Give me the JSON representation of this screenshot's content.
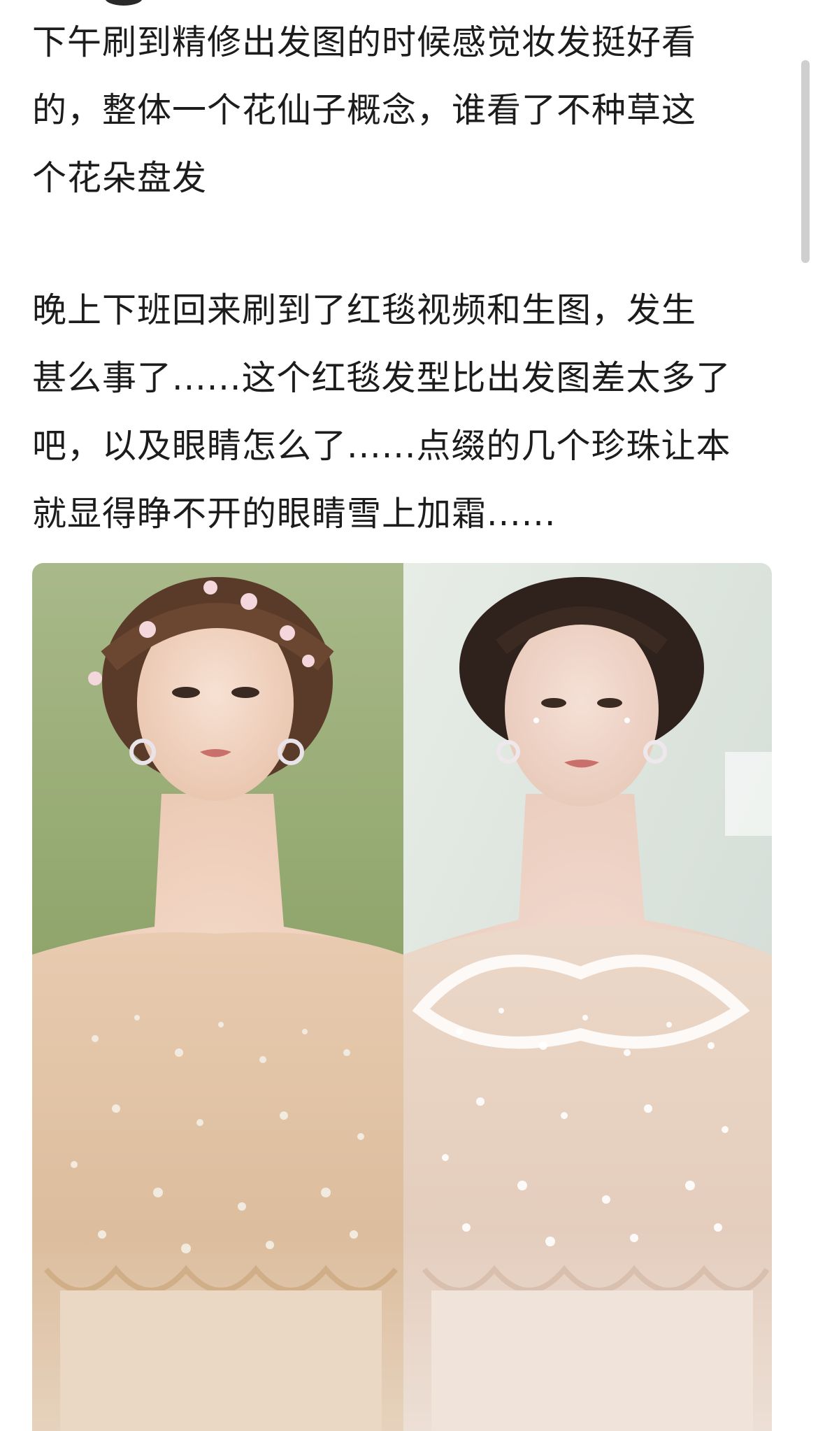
{
  "post": {
    "paragraph_1": "下午刷到精修出发图的时候感觉妆发挺好看\n的，整体一个花仙子概念，谁看了不种草这\n个花朵盘发",
    "paragraph_2": "晚上下班回来刷到了红毯视频和生图，发生\n甚么事了......这个红毯发型比出发图差太多了\n吧，以及眼睛怎么了......点缀的几个珍珠让本\n就显得睁不开的眼睛雪上加霜......"
  },
  "images": {
    "left_photo": {
      "icon": "portrait-photo-floral-hair-icon"
    },
    "right_photo": {
      "icon": "portrait-photo-red-carpet-icon"
    }
  },
  "colors": {
    "text": "#1c1c1c",
    "background": "#ffffff"
  }
}
